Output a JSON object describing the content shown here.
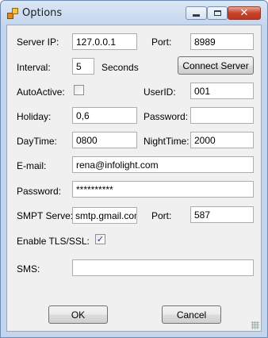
{
  "window": {
    "title": "Options",
    "icons": {
      "app": "app-icon",
      "minimize": "minimize-icon",
      "maximize": "maximize-icon",
      "close": "close-icon"
    }
  },
  "form": {
    "server_ip_label": "Server IP:",
    "server_ip_value": "127.0.0.1",
    "port_label": "Port:",
    "port_value": "8989",
    "interval_label": "Interval:",
    "interval_value": "5",
    "seconds_label": "Seconds",
    "connect_button": "Connect Server",
    "autoactive_label": "AutoActive:",
    "autoactive_checked": false,
    "userid_label": "UserID:",
    "userid_value": "001",
    "holiday_label": "Holiday:",
    "holiday_value": "0,6",
    "password_label": "Password:",
    "password_value": "",
    "daytime_label": "DayTime:",
    "daytime_value": "0800",
    "nighttime_label": "NightTime:",
    "nighttime_value": "2000",
    "email_label": "E-mail:",
    "email_value": "rena@infolight.com",
    "email_password_label": "Password:",
    "email_password_value": "**********",
    "smtp_label": "SMPT Serve:",
    "smtp_value": "smtp.gmail.com",
    "smtp_port_label": "Port:",
    "smtp_port_value": "587",
    "tls_label": "Enable TLS/SSL:",
    "tls_checked": true,
    "sms_label": "SMS:",
    "sms_value": ""
  },
  "buttons": {
    "ok": "OK",
    "cancel": "Cancel"
  },
  "check_glyph": "✓"
}
